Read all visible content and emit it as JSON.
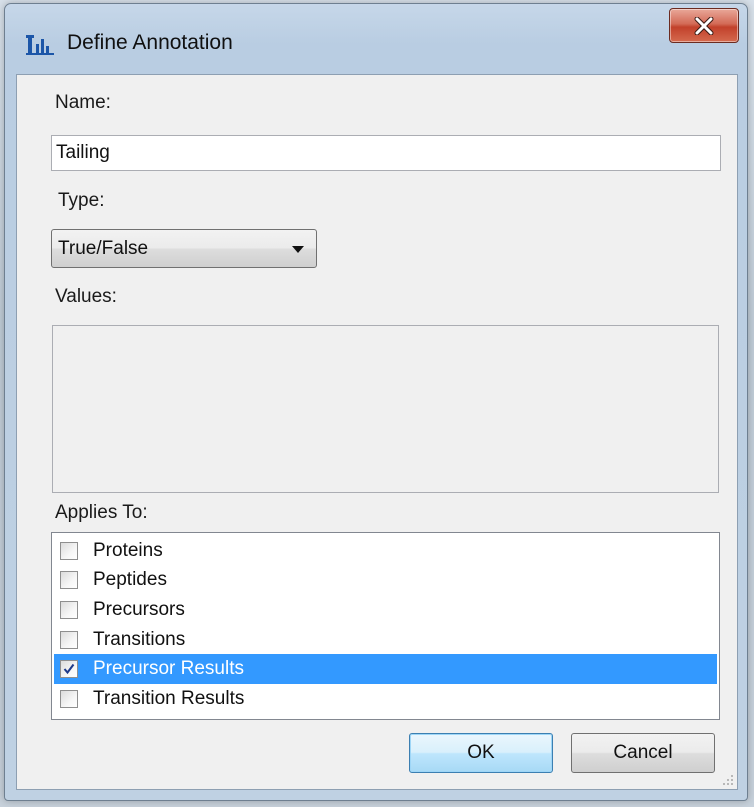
{
  "window": {
    "title": "Define Annotation",
    "app_icon": "chart-bars-icon",
    "close_label": "X"
  },
  "form": {
    "name_label": "Name:",
    "name_value": "Tailing",
    "type_label": "Type:",
    "type_selected": "True/False",
    "values_label": "Values:",
    "applies_label": "Applies To:",
    "applies_items": [
      {
        "label": "Proteins",
        "checked": false,
        "selected": false
      },
      {
        "label": "Peptides",
        "checked": false,
        "selected": false
      },
      {
        "label": "Precursors",
        "checked": false,
        "selected": false
      },
      {
        "label": "Transitions",
        "checked": false,
        "selected": false
      },
      {
        "label": "Precursor Results",
        "checked": true,
        "selected": true
      },
      {
        "label": "Transition Results",
        "checked": false,
        "selected": false
      }
    ]
  },
  "buttons": {
    "ok_label": "OK",
    "cancel_label": "Cancel"
  },
  "colors": {
    "selection": "#3399ff",
    "close_button": "#c2412b",
    "dialog_face": "#f0f0f0"
  }
}
